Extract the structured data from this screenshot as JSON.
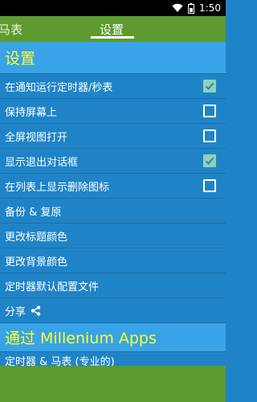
{
  "status_bar": {
    "time": "1:50"
  },
  "tabs": [
    {
      "label": "马表"
    },
    {
      "label": "设置"
    }
  ],
  "sections": [
    {
      "title": "设置",
      "items": [
        {
          "label": "在通知运行定时器/秒表",
          "checkbox": true,
          "checked": true
        },
        {
          "label": "保持屏幕上",
          "checkbox": true,
          "checked": false
        },
        {
          "label": "全屏视图打开",
          "checkbox": true,
          "checked": false
        },
        {
          "label": "显示退出对话框",
          "checkbox": true,
          "checked": true
        },
        {
          "label": "在列表上显示删除图标",
          "checkbox": true,
          "checked": false
        },
        {
          "label": "备份 & 复原"
        },
        {
          "label": "更改标题颜色"
        },
        {
          "label": "更改背景颜色"
        },
        {
          "label": "定时器默认配置文件"
        },
        {
          "label": "分享"
        }
      ]
    },
    {
      "title": "通过 Millenium Apps",
      "items": [
        {
          "label": "定时器 & 马表 (专业的)"
        }
      ]
    }
  ]
}
